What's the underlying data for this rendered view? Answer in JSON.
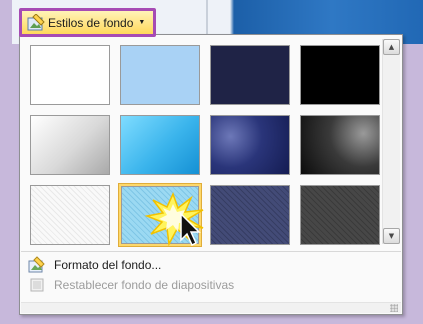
{
  "gallery_button": {
    "label": "Estilos de fondo",
    "icon": "background-styles-icon"
  },
  "swatches": [
    {
      "name": "plain-white",
      "fill": "#ffffff",
      "style": "plain"
    },
    {
      "name": "light-blue",
      "fill": "#a9d2f5",
      "style": "plain"
    },
    {
      "name": "dark-navy",
      "fill": "#1f2346",
      "style": "plain"
    },
    {
      "name": "black",
      "fill": "#000000",
      "style": "plain"
    },
    {
      "name": "gray-gradient",
      "fill": "#d4d4d4",
      "style": "gradient-light"
    },
    {
      "name": "cyan-gradient",
      "fill": "#3ab4ec",
      "style": "gradient-cyan"
    },
    {
      "name": "navy-gradient",
      "fill": "#1c2769",
      "style": "gradient-navy"
    },
    {
      "name": "black-gradient",
      "fill": "#333333",
      "style": "gradient-dark"
    },
    {
      "name": "white-texture",
      "fill": "#f2f2f2",
      "style": "texture-light"
    },
    {
      "name": "cyan-texture",
      "fill": "#8fd3ef",
      "style": "texture-cyan",
      "selected": true
    },
    {
      "name": "navy-texture",
      "fill": "#3a426b",
      "style": "texture-navy"
    },
    {
      "name": "dark-texture",
      "fill": "#3f3f3f",
      "style": "texture-dark"
    }
  ],
  "menu": {
    "format_background": "Formato del fondo...",
    "reset_background": "Restablecer fondo de diapositivas"
  },
  "colors": {
    "highlight_border": "#a64bb4",
    "button_fill": "#ffd85c"
  }
}
